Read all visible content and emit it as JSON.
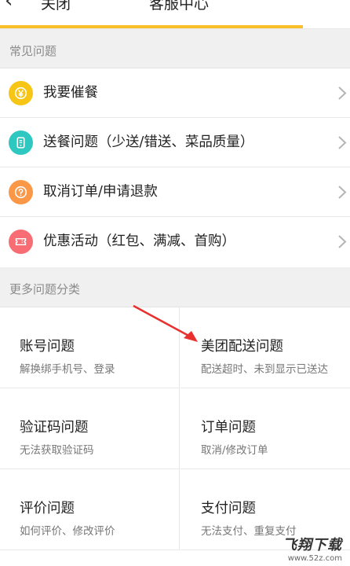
{
  "header": {
    "back_glyph": "‹",
    "close_label": "关闭",
    "title": "客服中心",
    "progress_fraction": 0.865
  },
  "faq": {
    "section_title": "常见问题",
    "items": [
      {
        "label": "我要催餐",
        "icon": "yen-clock-icon",
        "color": "#f6c515"
      },
      {
        "label": "送餐问题（少送/错送、菜品质量）",
        "icon": "phone-order-icon",
        "color": "#2ec8c0"
      },
      {
        "label": "取消订单/申请退款",
        "icon": "cancel-question-icon",
        "color": "#fb9847"
      },
      {
        "label": "优惠活动（红包、满减、首购）",
        "icon": "coupon-icon",
        "color": "#f86d73"
      }
    ]
  },
  "more": {
    "section_title": "更多问题分类",
    "categories": [
      {
        "title": "账号问题",
        "subtitle": "解换绑手机号、登录"
      },
      {
        "title": "美团配送问题",
        "subtitle": "配送超时、未到显示已送达"
      },
      {
        "title": "验证码问题",
        "subtitle": "无法获取验证码"
      },
      {
        "title": "订单问题",
        "subtitle": "取消/修改订单"
      },
      {
        "title": "评价问题",
        "subtitle": "如何评价、修改评价"
      },
      {
        "title": "支付问题",
        "subtitle": "无法支付、重复支付"
      }
    ]
  },
  "watermark": {
    "brand": "飞翔下载",
    "url": "www.52z.com"
  },
  "colors": {
    "accent": "#f9c02a",
    "annotation_arrow": "#e8312f"
  }
}
